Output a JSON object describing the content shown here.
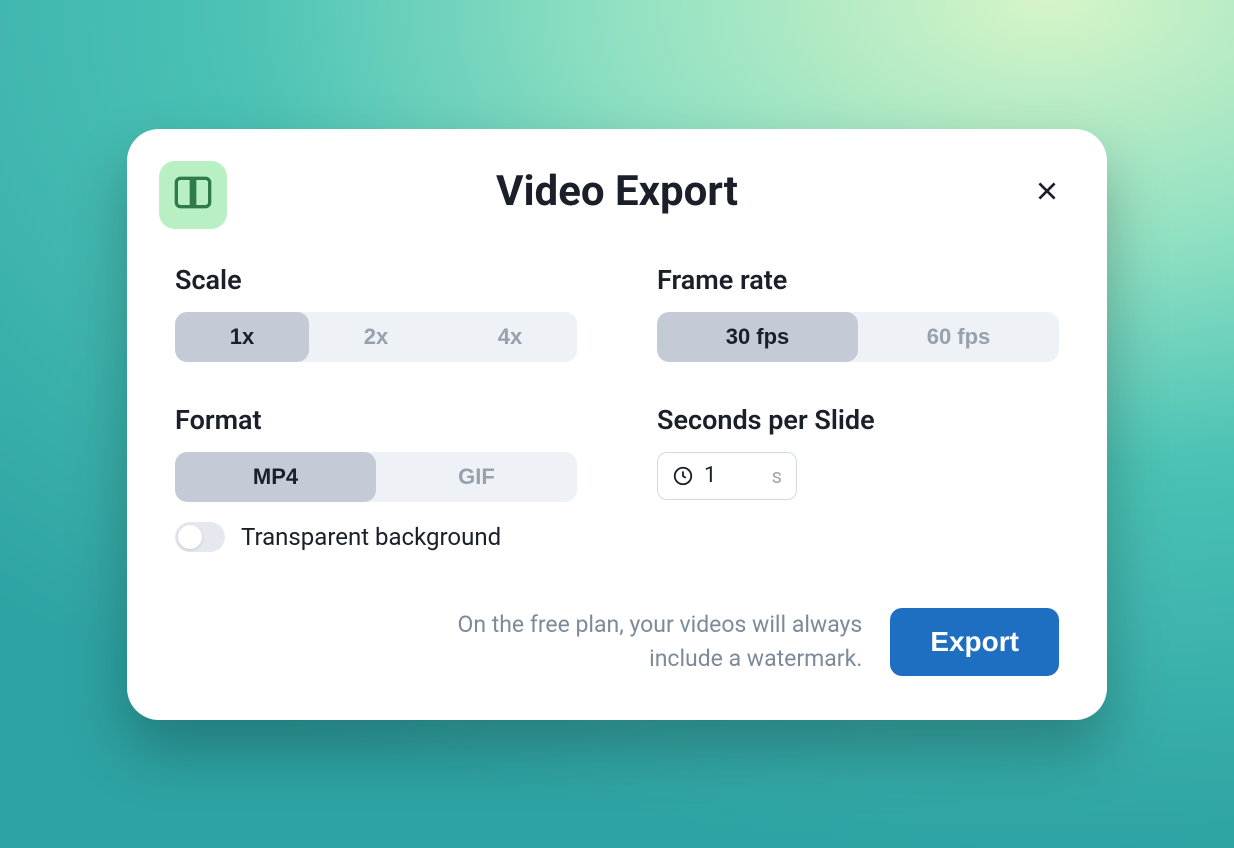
{
  "dialog": {
    "title": "Video Export"
  },
  "scale": {
    "label": "Scale",
    "options": [
      "1x",
      "2x",
      "4x"
    ],
    "selected": "1x"
  },
  "framerate": {
    "label": "Frame rate",
    "options": [
      "30 fps",
      "60 fps"
    ],
    "selected": "30 fps"
  },
  "format": {
    "label": "Format",
    "options": [
      "MP4",
      "GIF"
    ],
    "selected": "MP4"
  },
  "transparent": {
    "label": "Transparent background",
    "enabled": false
  },
  "seconds": {
    "label": "Seconds per Slide",
    "value": "1",
    "unit": "s"
  },
  "footer": {
    "disclaimer": "On the free plan, your videos will always include a watermark.",
    "export_label": "Export"
  }
}
